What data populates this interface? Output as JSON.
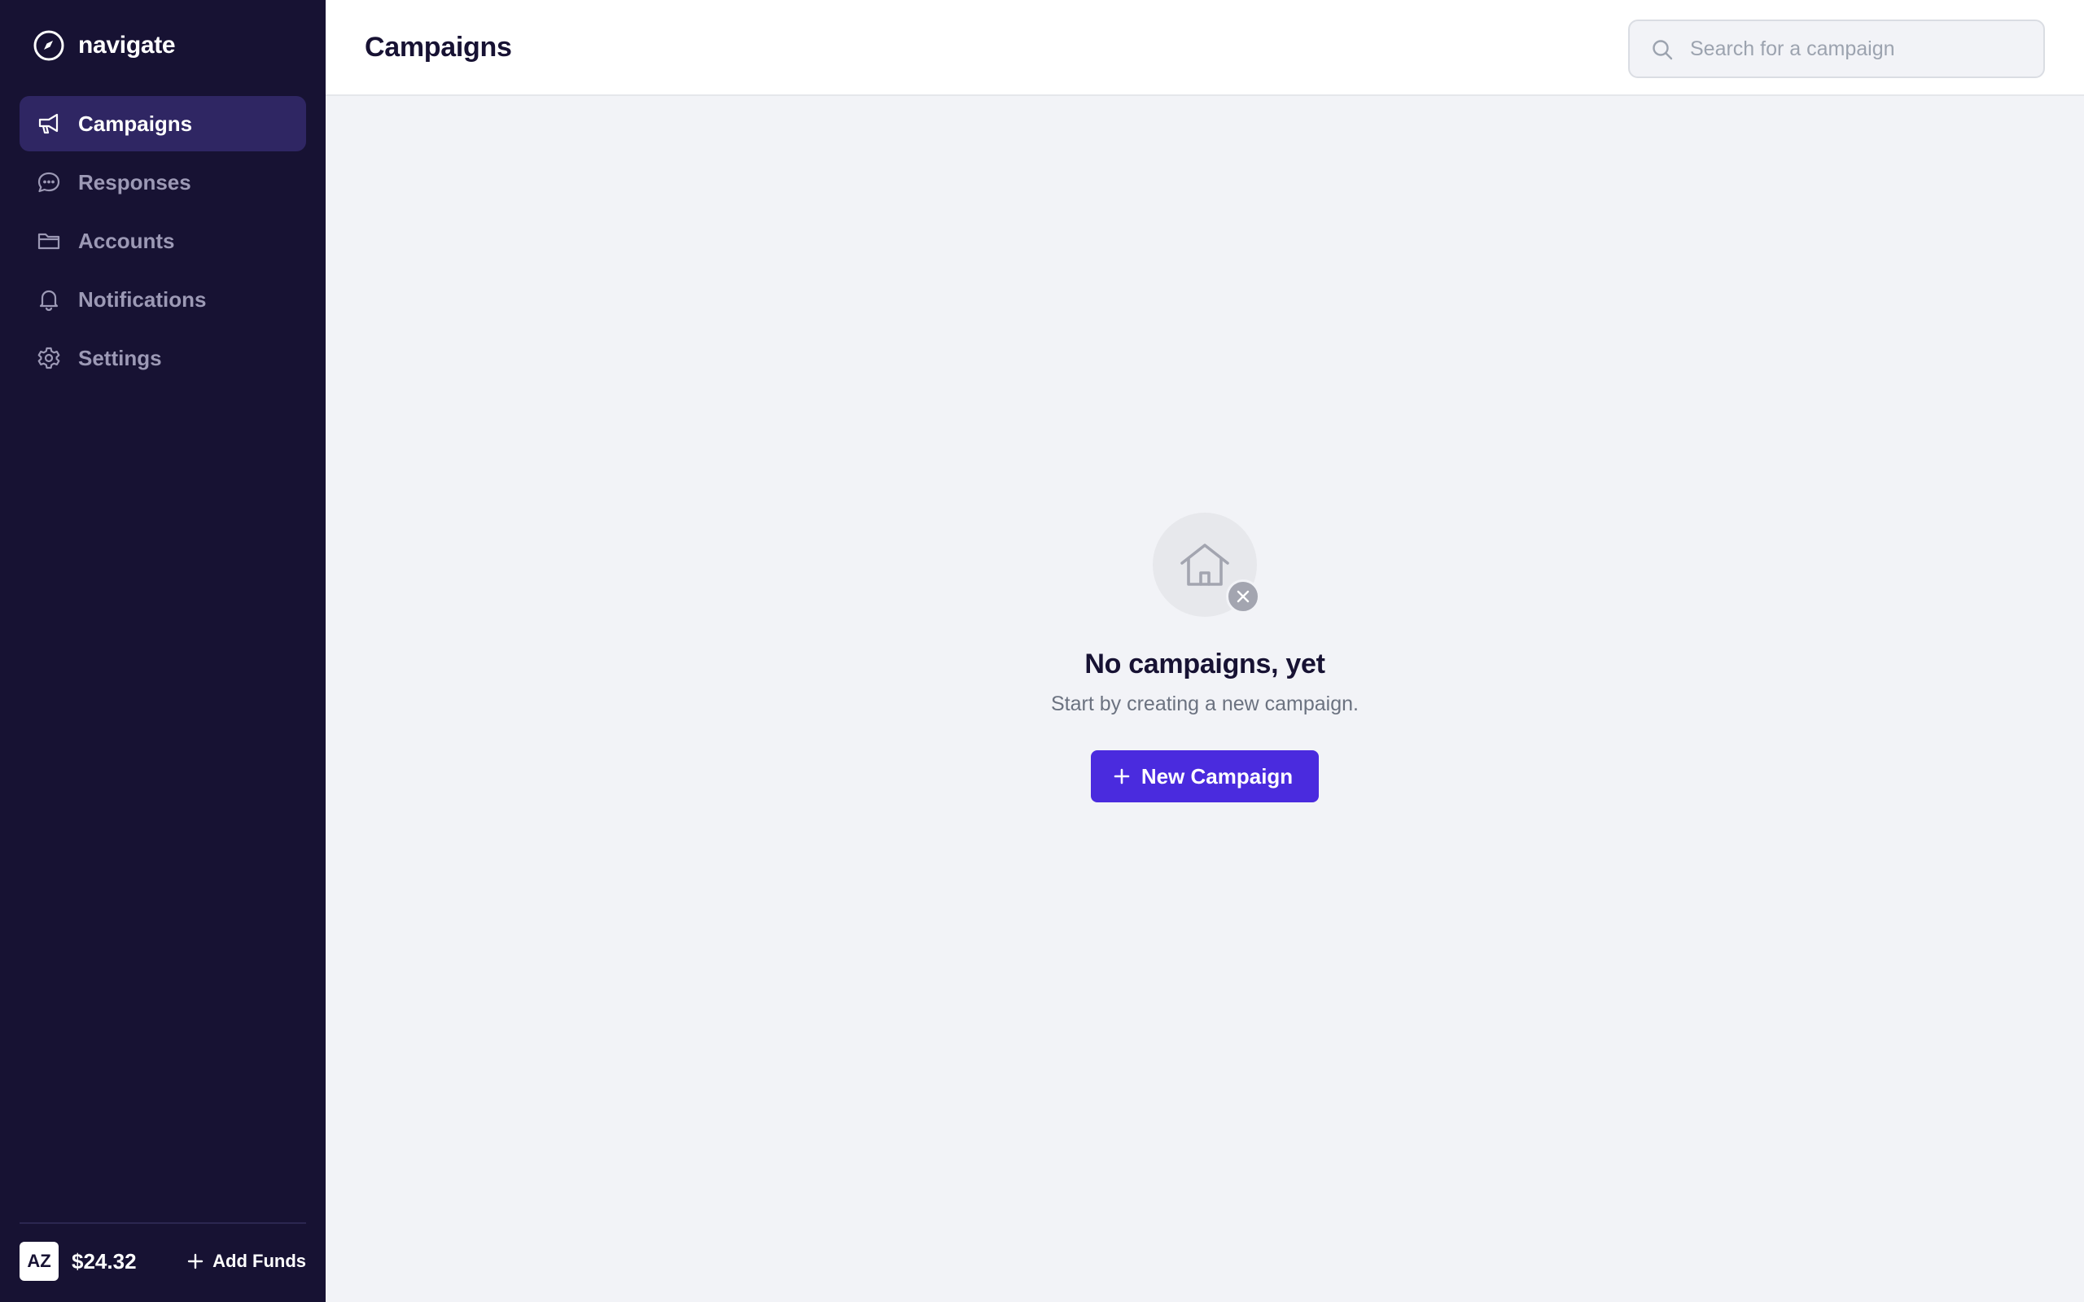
{
  "app": {
    "name": "navigate",
    "logo_icon": "compass-icon"
  },
  "sidebar": {
    "items": [
      {
        "label": "Campaigns",
        "icon": "megaphone-icon",
        "active": true
      },
      {
        "label": "Responses",
        "icon": "chat-bubble-icon",
        "active": false
      },
      {
        "label": "Accounts",
        "icon": "folder-icon",
        "active": false
      },
      {
        "label": "Notifications",
        "icon": "bell-icon",
        "active": false
      },
      {
        "label": "Settings",
        "icon": "gear-icon",
        "active": false
      }
    ],
    "footer": {
      "avatar_initials": "AZ",
      "balance": "$24.32",
      "add_funds_label": "Add Funds",
      "add_funds_icon": "plus-icon"
    }
  },
  "header": {
    "title": "Campaigns",
    "search": {
      "placeholder": "Search for a campaign",
      "value": "",
      "icon": "search-icon"
    }
  },
  "empty_state": {
    "illustration_icon": "house-icon",
    "badge_icon": "x-icon",
    "title": "No campaigns, yet",
    "subtitle": "Start by creating a new campaign.",
    "button_label": "New Campaign",
    "button_icon": "plus-icon"
  },
  "colors": {
    "sidebar_bg": "#171233",
    "sidebar_active_bg": "#2f2663",
    "sidebar_text": "#9c99b5",
    "content_bg": "#f2f3f7",
    "primary": "#4a2bde",
    "heading": "#171233",
    "muted": "#6b7280"
  }
}
